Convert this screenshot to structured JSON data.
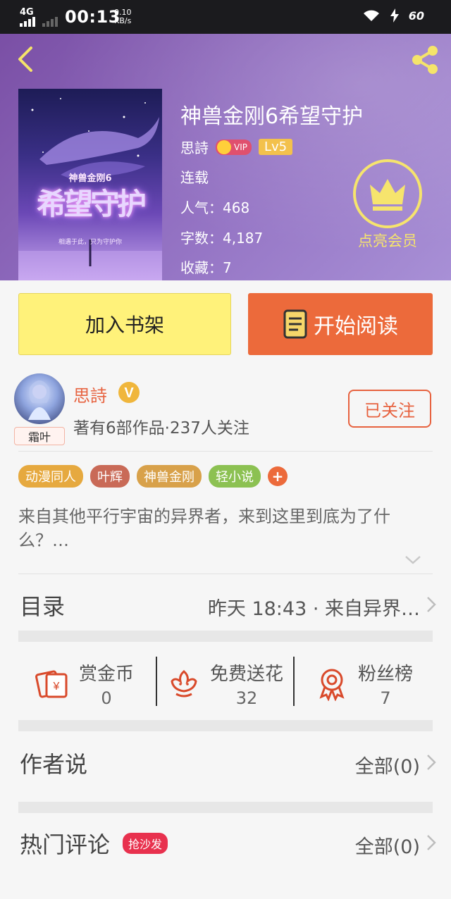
{
  "status_bar": {
    "network": "4G",
    "time": "00:13",
    "speed_value": "0.10",
    "speed_unit": "KB/s",
    "battery": "60"
  },
  "header": {
    "book_title": "神兽金刚6希望守护",
    "author": "思詩",
    "vip_label": "VIP",
    "level": "Lv5",
    "status": "连载",
    "popularity": "人气：468",
    "word_count": "字数：4,187",
    "favorites": "收藏：7",
    "member_label": "点亮会员",
    "cover": {
      "series_label": "神兽金刚6",
      "title_art": "希望守护",
      "footer": "相遇于此，只为守护你"
    }
  },
  "actions": {
    "add_shelf": "加入书架",
    "start_reading": "开始阅读"
  },
  "author_card": {
    "name": "思詩",
    "v_badge": "V",
    "stats": "著有6部作品·237人关注",
    "follow_label": "已关注",
    "avatar_tag": "霜叶"
  },
  "tags": [
    {
      "label": "动漫同人",
      "color": "#e6a93f"
    },
    {
      "label": "叶辉",
      "color": "#c96a57"
    },
    {
      "label": "神兽金刚",
      "color": "#d8a14a"
    },
    {
      "label": "轻小说",
      "color": "#8cc152"
    }
  ],
  "tag_add": "+",
  "description": "来自其他平行宇宙的异界者，来到这里到底为了什么？…",
  "catalog": {
    "title": "目录",
    "latest": "昨天 18:43 · 来自异界…"
  },
  "stats": [
    {
      "label": "赏金币",
      "value": "0",
      "icon": "coin-gift-icon"
    },
    {
      "label": "免费送花",
      "value": "32",
      "icon": "flower-icon"
    },
    {
      "label": "粉丝榜",
      "value": "7",
      "icon": "ribbon-medal-icon"
    }
  ],
  "author_says": {
    "title": "作者说",
    "all": "全部(0)"
  },
  "hot_comments": {
    "title": "热门评论",
    "badge": "抢沙发",
    "all": "全部(0)"
  },
  "colors": {
    "accent_orange": "#ec6a3b",
    "shelf_yellow": "#fff27a",
    "member_gold": "#f6e46d",
    "header_purple": "#8f6cbf"
  }
}
